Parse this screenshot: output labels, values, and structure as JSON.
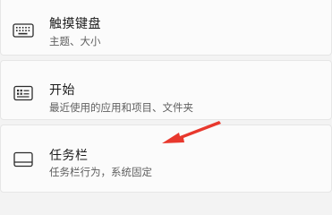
{
  "settings_items": [
    {
      "title": "触摸键盘",
      "subtitle": "主题、大小",
      "icon": "keyboard-icon"
    },
    {
      "title": "开始",
      "subtitle": "最近使用的应用和项目、文件夹",
      "icon": "start-menu-icon"
    },
    {
      "title": "任务栏",
      "subtitle": "任务栏行为，系统固定",
      "icon": "taskbar-icon"
    }
  ],
  "annotation": {
    "arrow_color": "#e8382d"
  }
}
